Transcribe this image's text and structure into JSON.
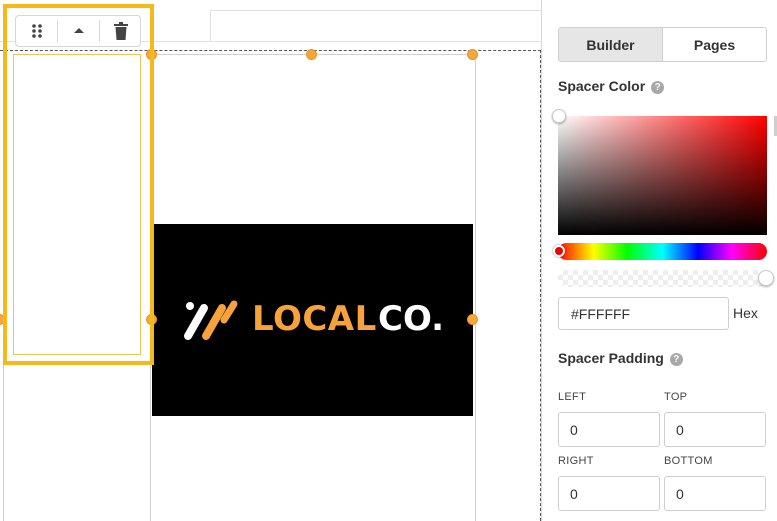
{
  "canvas": {
    "logo": {
      "word_local": "LOCAL",
      "word_co": "CO.",
      "brand_orange": "#F8A23B",
      "background": "#000000"
    },
    "selection_color": "#F7B81C",
    "handle_color": "#F5A83A",
    "toolbar": {
      "drag_icon": "drag-handle-icon",
      "up_icon": "caret-up-icon",
      "delete_icon": "trash-icon"
    }
  },
  "panel": {
    "tabs": [
      {
        "label": "Builder",
        "active": true
      },
      {
        "label": "Pages",
        "active": false
      }
    ],
    "spacer_color": {
      "title": "Spacer Color",
      "help_icon": "question-circle-icon",
      "hex_value": "#FFFFFF",
      "hex_label": "Hex",
      "hue": "#FF0000"
    },
    "spacer_padding": {
      "title": "Spacer Padding",
      "help_icon": "question-circle-icon",
      "left_label": "LEFT",
      "left_value": "0",
      "top_label": "TOP",
      "top_value": "0",
      "right_label": "RIGHT",
      "right_value": "0",
      "bottom_label": "BOTTOM",
      "bottom_value": "0"
    }
  }
}
